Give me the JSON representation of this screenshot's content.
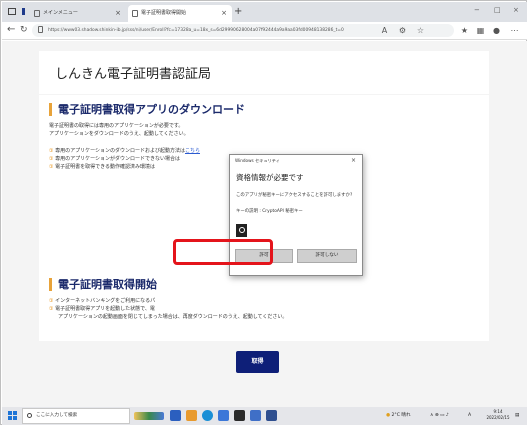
{
  "browser": {
    "tabs": [
      {
        "label": "メインメニュー",
        "active": false
      },
      {
        "label": "電子証明書取得開始",
        "active": true
      }
    ],
    "new_tab": "+",
    "window_controls": [
      "−",
      "□",
      "×"
    ],
    "url": "https://www03.shadow.shinkin-ib.jp/sss/ni/user/Enroll?fc=17328a_u=18x_s=6d29990628004a07f92444a9a9aa03fd00948138286_t=0",
    "icons": [
      "back-icon",
      "refresh-icon",
      "lock-icon",
      "read-aloud-icon",
      "favorite-add-icon",
      "favorites-icon",
      "collections-icon",
      "profile-icon",
      "more-icon"
    ]
  },
  "page": {
    "site_title": "しんきん電子証明書認証局",
    "section1": {
      "heading": "電子証明書取得アプリのダウンロード",
      "desc_line1": "電子証明書の取得には専用のアプリケーションが必要です。",
      "desc_line2": "アプリケーションをダウンロードのうえ、起動してください。",
      "notes": [
        {
          "mark": "①",
          "text": "専用のアプリケーションのダウンロードおよび起動方法は",
          "link": "こちら"
        },
        {
          "mark": "①",
          "text": "専用のアプリケーションがダウンロードできない場合は",
          "link": ""
        },
        {
          "mark": "①",
          "text": "電子証明書を取得できる動作確認済み環境は",
          "link": ""
        }
      ]
    },
    "section2": {
      "heading": "電子証明書取得開始",
      "notes": [
        {
          "mark": "①",
          "text": "インターネットバンキングをご利用になるパ"
        },
        {
          "mark": "①",
          "text": "電子証明書取得アプリを起動した状態で、電"
        }
      ],
      "note_cont": "アプリケーションの起動画面を閉じてしまった場合は、再度ダウンロードのうえ、起動してください。",
      "acquire_button": "取得"
    }
  },
  "dialog": {
    "caption": "Windows セキュリティ",
    "close": "×",
    "heading": "資格情報が必要です",
    "question": "このアプリが秘密キーにアクセスすることを許可しますか?",
    "key_desc": "キーの説明 : CryptoAPI 秘密キー",
    "allow_button": "許可",
    "deny_button": "許可しない"
  },
  "taskbar": {
    "search_placeholder": "ここに入力して検索",
    "weather": "2°C 晴れ",
    "ime": "A",
    "time": "9:14",
    "date": "2022/02/15"
  },
  "colors": {
    "heading": "#1b2a6b",
    "accent_bar": "#e8a33a",
    "button": "#0e1f78",
    "highlight": "#e4141b"
  }
}
